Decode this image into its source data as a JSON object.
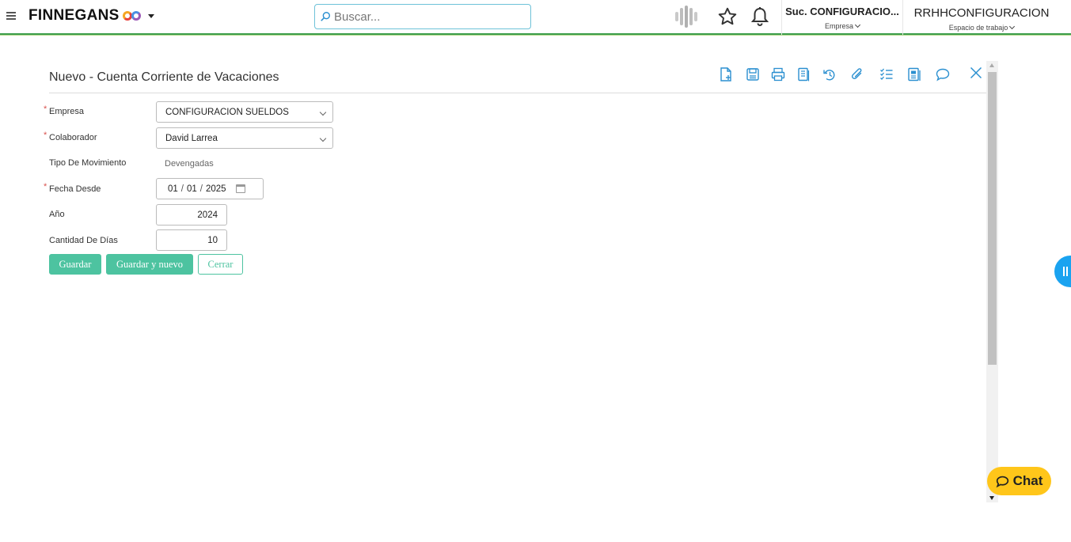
{
  "header": {
    "brand": "FINNEGANS",
    "search_placeholder": "Buscar...",
    "empresa_value": "Suc. CONFIGURACIO...",
    "empresa_label": "Empresa",
    "espacio_value": "RRHHCONFIGURACION",
    "espacio_label": "Espacio de trabajo",
    "accent_color": "#3c9d4b"
  },
  "form": {
    "title": "Nuevo - Cuenta Corriente de Vacaciones",
    "fields": {
      "empresa": {
        "label": "Empresa",
        "value": "CONFIGURACION SUELDOS"
      },
      "colaborador": {
        "label": "Colaborador",
        "value": "David Larrea"
      },
      "tipo_movimiento": {
        "label": "Tipo De Movimiento",
        "value": "Devengadas"
      },
      "fecha_desde": {
        "label": "Fecha Desde",
        "day": "01",
        "month": "01",
        "year": "2025"
      },
      "anio": {
        "label": "Año",
        "value": "2024"
      },
      "cantidad_dias": {
        "label": "Cantidad De Días",
        "value": "10"
      }
    },
    "required_mark": "*",
    "buttons": {
      "guardar": "Guardar",
      "guardar_nuevo": "Guardar y nuevo",
      "cerrar": "Cerrar"
    },
    "button_color": "#4dc3a0"
  },
  "toolbar_icons": [
    "new-document-icon",
    "save-icon",
    "print-icon",
    "copy-icon",
    "history-icon",
    "attach-icon",
    "checklist-icon",
    "report-icon",
    "comment-icon",
    "close-icon"
  ],
  "chat": {
    "label": "Chat",
    "color": "#ffc61a"
  }
}
